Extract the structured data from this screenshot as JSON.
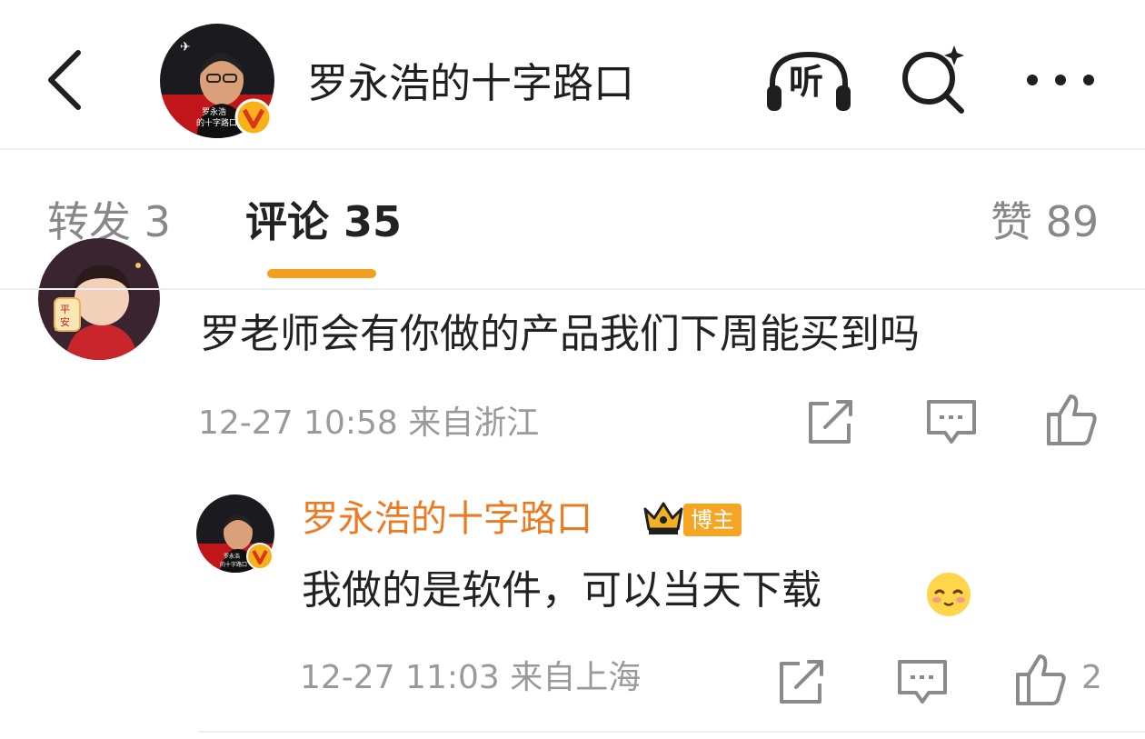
{
  "header": {
    "title": "罗永浩的十字路口",
    "listen_label": "听",
    "avatar_caption": [
      "罗永浩",
      "的十字路口"
    ]
  },
  "tabs": {
    "repost": "转发 3",
    "comment": "评论 35",
    "like": "赞 89"
  },
  "comments": [
    {
      "text": "罗老师会有你做的产品我们下周能买到吗",
      "meta": "12-27 10:58  来自浙江",
      "avatar_caption": "平安"
    }
  ],
  "reply": {
    "author": "罗永浩的十字路口",
    "badge": "博主",
    "text": "我做的是软件，可以当天下载",
    "meta": "12-27 11:03  来自上海",
    "like_count": "2"
  },
  "colors": {
    "accent": "#f3a022",
    "author": "#eb7a20",
    "muted": "#9a9a9a"
  }
}
